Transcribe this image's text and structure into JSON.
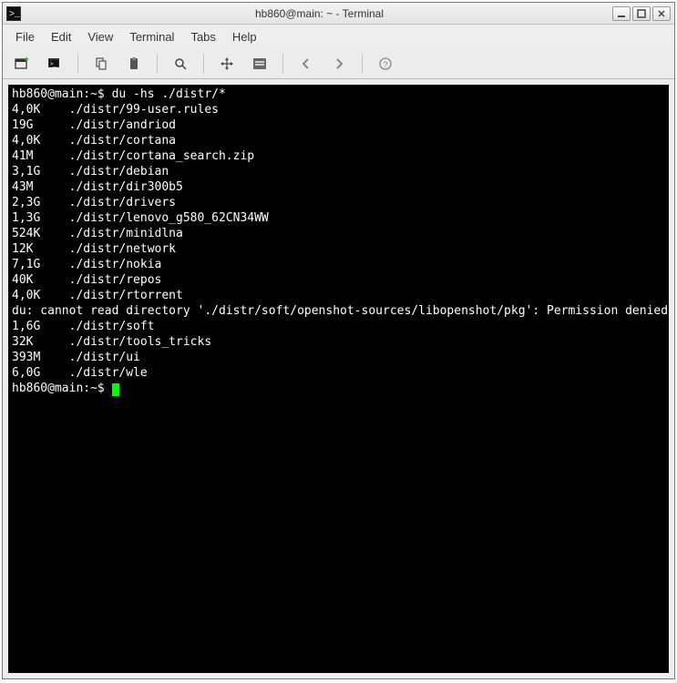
{
  "window": {
    "title": "hb860@main: ~ - Terminal"
  },
  "menu": {
    "file": "File",
    "edit": "Edit",
    "view": "View",
    "terminal": "Terminal",
    "tabs": "Tabs",
    "help": "Help"
  },
  "terminal": {
    "prompt1": "hb860@main:~$ ",
    "command": "du -hs ./distr/*",
    "results": [
      {
        "size": "4,0K",
        "path": "./distr/99-user.rules"
      },
      {
        "size": "19G",
        "path": "./distr/andriod"
      },
      {
        "size": "4,0K",
        "path": "./distr/cortana"
      },
      {
        "size": "41M",
        "path": "./distr/cortana_search.zip"
      },
      {
        "size": "3,1G",
        "path": "./distr/debian"
      },
      {
        "size": "43M",
        "path": "./distr/dir300b5"
      },
      {
        "size": "2,3G",
        "path": "./distr/drivers"
      },
      {
        "size": "1,3G",
        "path": "./distr/lenovo_g580_62CN34WW"
      },
      {
        "size": "524K",
        "path": "./distr/minidlna"
      },
      {
        "size": "12K",
        "path": "./distr/network"
      },
      {
        "size": "7,1G",
        "path": "./distr/nokia"
      },
      {
        "size": "40K",
        "path": "./distr/repos"
      },
      {
        "size": "4,0K",
        "path": "./distr/rtorrent"
      }
    ],
    "error_msg": "du: cannot read directory './distr/soft/openshot-sources/libopenshot/pkg': Permission denied",
    "results2": [
      {
        "size": "1,6G",
        "path": "./distr/soft"
      },
      {
        "size": "32K",
        "path": "./distr/tools_tricks"
      },
      {
        "size": "393M",
        "path": "./distr/ui"
      },
      {
        "size": "6,0G",
        "path": "./distr/wle"
      }
    ],
    "prompt2": "hb860@main:~$ "
  }
}
